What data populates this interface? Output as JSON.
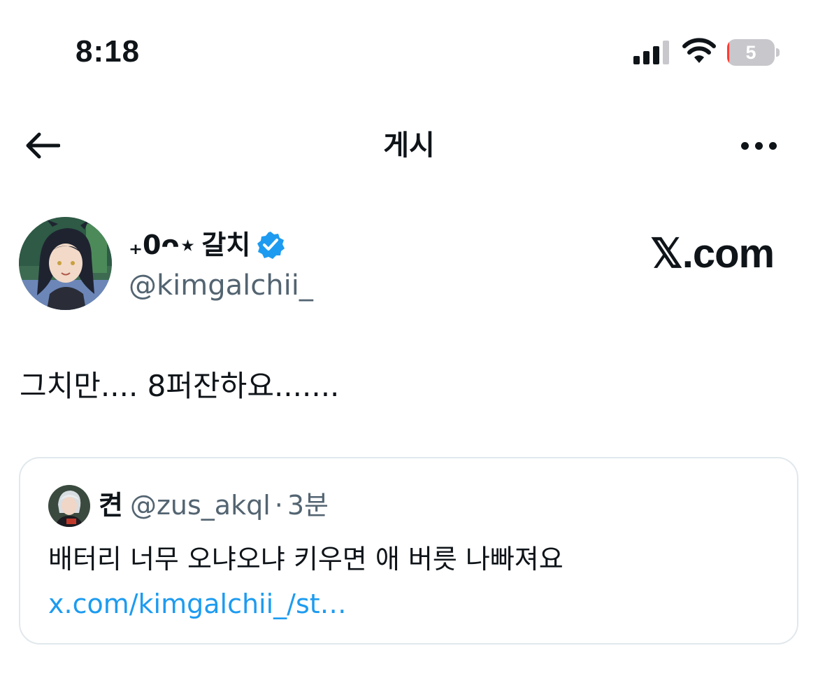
{
  "status_bar": {
    "time": "8:18",
    "battery_level": "5",
    "battery_fraction": 0.05,
    "battery_color": "#ff3b30",
    "signal_bars": 3
  },
  "header": {
    "title": "게시",
    "back_icon": "arrow-left-icon",
    "more_icon": "ellipsis-icon"
  },
  "post": {
    "author": {
      "name_prefix": "₊0ᴖ⋆",
      "name": "갈치",
      "handle": "@kimgalchii_",
      "verified": true,
      "verified_color": "#1d9bf0"
    },
    "brand": "𝕏.com",
    "text": "그치만.... 8퍼잔하요......."
  },
  "quoted_post": {
    "author_name": "켠",
    "handle": "@zus_akql",
    "separator": "·",
    "time": "3분",
    "text": "배터리 너무 오냐오냐 키우면 애 버릇 나빠져요 ",
    "link": "x.com/kimgalchii_/st…",
    "link_color": "#1d9bf0"
  }
}
